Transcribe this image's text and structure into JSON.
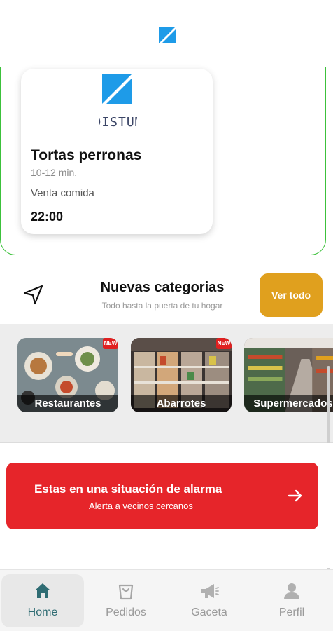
{
  "store": {
    "logo_text": "DISTUM",
    "name": "Tortas perronas",
    "time": "10-12 min.",
    "type": "Venta comida",
    "hour": "22:00"
  },
  "categories": {
    "title": "Nuevas categorias",
    "subtitle": "Todo hasta la puerta de tu hogar",
    "see_all_label": "Ver todo",
    "items": [
      {
        "label": "Restaurantes",
        "badge": "NEW"
      },
      {
        "label": "Abarrotes",
        "badge": "NEW"
      },
      {
        "label": "Supermercados",
        "badge": ""
      }
    ]
  },
  "alarm": {
    "title": "Estas en una situación de alarma",
    "subtitle": "Alerta a vecinos cercanos"
  },
  "bottom_nav": {
    "items": [
      {
        "label": "Home",
        "icon": "home-icon",
        "active": true
      },
      {
        "label": "Pedidos",
        "icon": "bag-icon",
        "active": false
      },
      {
        "label": "Gaceta",
        "icon": "megaphone-icon",
        "active": false
      },
      {
        "label": "Perfil",
        "icon": "user-icon",
        "active": false
      }
    ]
  },
  "colors": {
    "brand_blue": "#1e9be8",
    "accent_orange": "#e0a01e",
    "alarm_red": "#e6252a",
    "active_teal": "#2f6c73",
    "card_border_green": "#3cc13b"
  }
}
